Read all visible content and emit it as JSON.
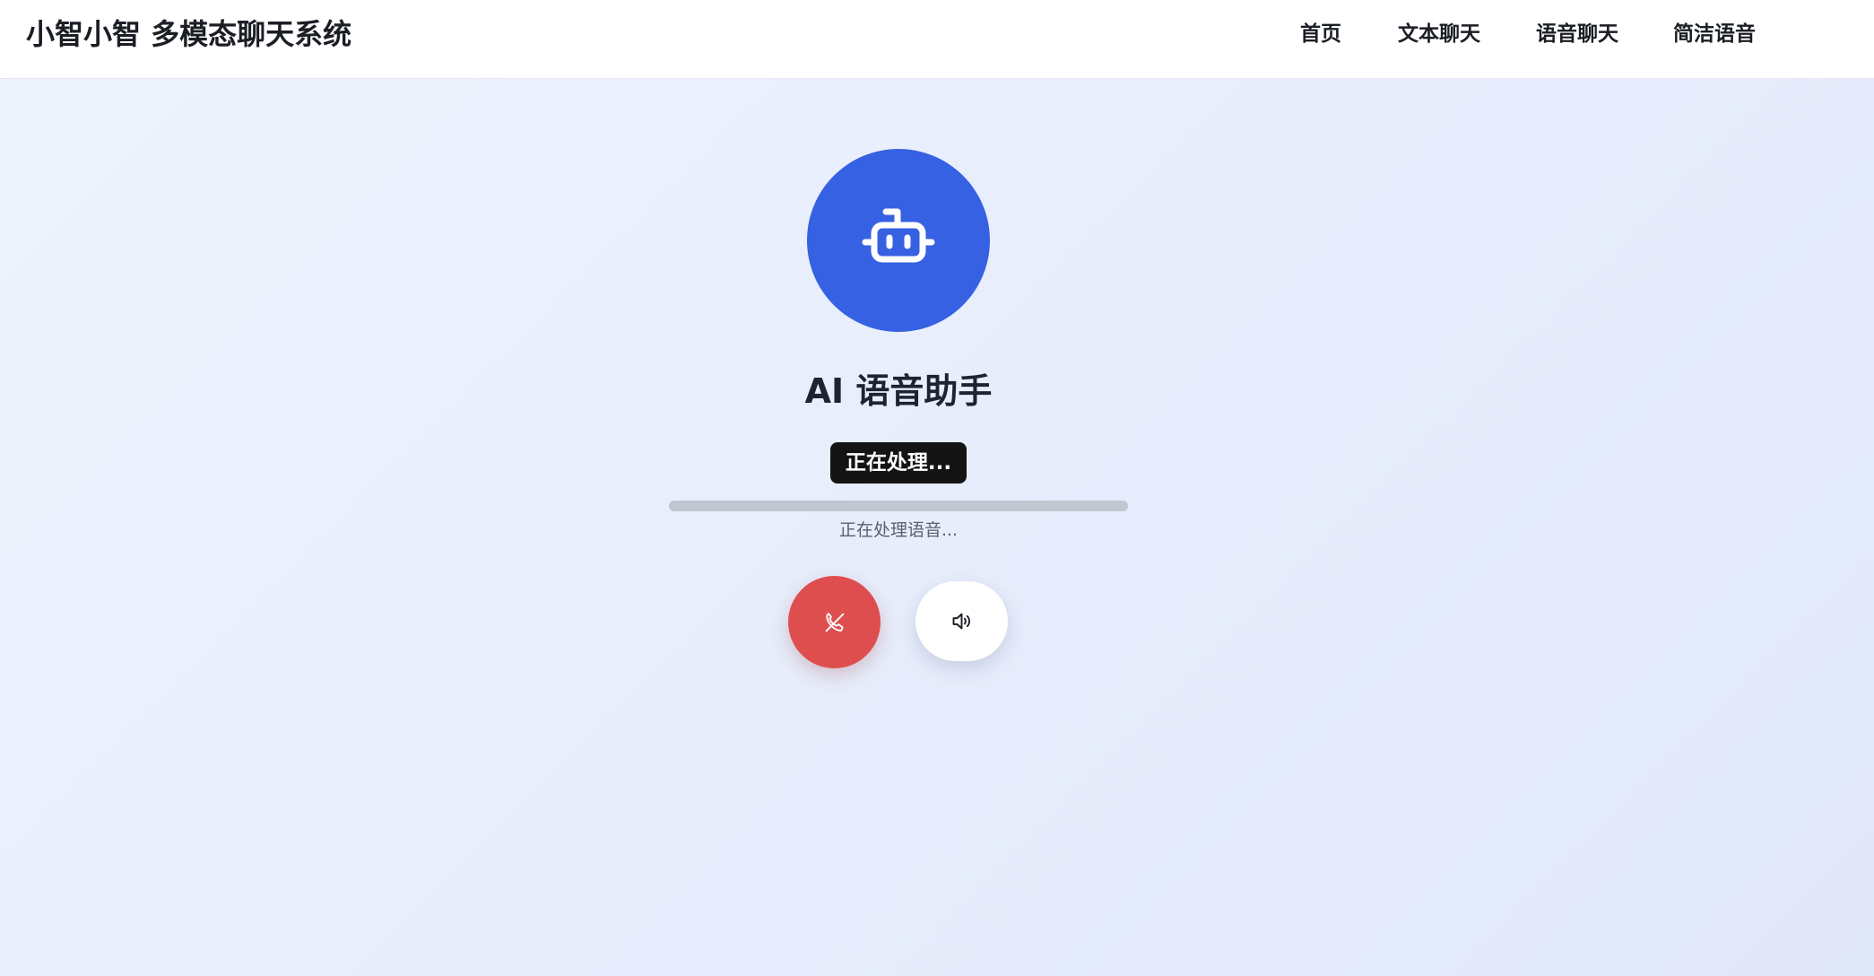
{
  "header": {
    "app_title": "小智小智 多模态聊天系统",
    "nav": [
      {
        "label": "首页"
      },
      {
        "label": "文本聊天"
      },
      {
        "label": "语音聊天"
      },
      {
        "label": "简洁语音"
      }
    ]
  },
  "call": {
    "avatar_icon": "robot-icon",
    "title": "AI 语音助手",
    "status_badge": "正在处理...",
    "progress": 0,
    "status_text": "正在处理语音...",
    "hangup_icon": "phone-off-icon",
    "speaker_icon": "speaker-icon"
  },
  "colors": {
    "accent": "#3661e2",
    "hangup": "#df4e4e",
    "badge": "#141414"
  }
}
